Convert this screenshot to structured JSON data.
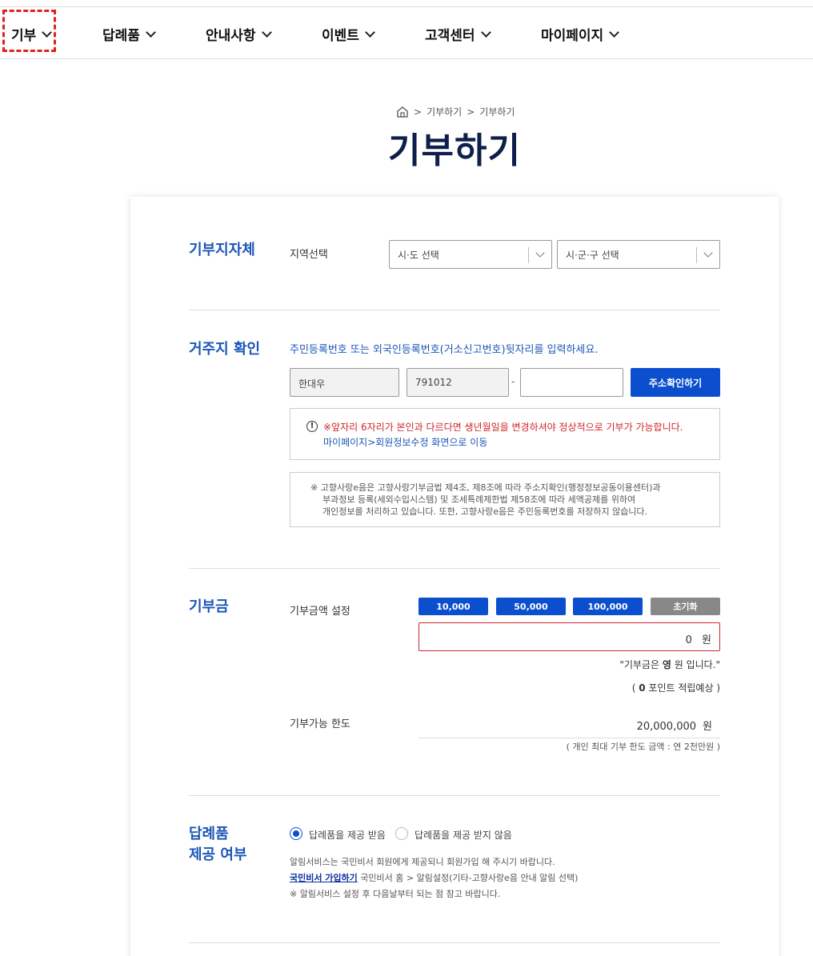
{
  "nav": {
    "items": [
      {
        "label": "기부"
      },
      {
        "label": "답례품"
      },
      {
        "label": "안내사항"
      },
      {
        "label": "이벤트"
      },
      {
        "label": "고객센터"
      },
      {
        "label": "마이페이지"
      }
    ]
  },
  "breadcrumb": {
    "items": [
      "기부하기",
      "기부하기"
    ],
    "separator": ">"
  },
  "page": {
    "title": "기부하기"
  },
  "region": {
    "section_title": "기부지자체",
    "label": "지역선택",
    "sido_placeholder": "시·도 선택",
    "sigungu_placeholder": "시·군·구 선택"
  },
  "residence": {
    "section_title": "거주지 확인",
    "instruction": "주민등록번호 또는 외국인등록번호(거소신고번호)뒷자리를 입력하세요.",
    "name_value": "한대우",
    "birth_value": "791012",
    "dash": "-",
    "rrn_back_value": "",
    "confirm_button": "주소확인하기",
    "warning_text": "※앞자리 6자리가 본인과 다르다면 생년월일을 변경하셔야 정상적으로 기부가 가능합니다.",
    "warning_link": "마이페이지>회원정보수정 화면으로 이동",
    "note_lines": [
      "※ 고향사랑e음은 고향사랑기부금법 제4조, 제8조에 따라 주소지확인(행정정보공동이용센터)과",
      "부과정보 등록(세외수입시스템) 및 조세특례제한법 제58조에 따라 세액공제를 위하여",
      "개인정보를 처리하고 있습니다. 또한, 고향사랑e음은 주민등록번호를 저장하지 않습니다."
    ]
  },
  "donation": {
    "section_title": "기부금",
    "amount_label": "기부금액 설정",
    "buttons": [
      "10,000",
      "50,000",
      "100,000",
      "초기화"
    ],
    "amount_value": "0",
    "unit": "원",
    "summary_prefix": "\"기부금은 ",
    "summary_bold": "영",
    "summary_suffix": " 원 입니다.\"",
    "points_prefix": "( ",
    "points_bold": "0",
    "points_suffix": " 포인트 적립예상 )",
    "limit_label": "기부가능 한도",
    "limit_value": "20,000,000",
    "limit_note": "( 개인 최대 기부 한도 금액 : 연 2천만원 )"
  },
  "gift": {
    "section_title_line1": "답례품",
    "section_title_line2": "제공 여부",
    "option_yes": "답례품을 제공 받음",
    "option_no": "답례품을 제공 받지 않음",
    "info_line1": "알림서비스는 국민비서 회원에게 제공되니 회원가입 해 주시기 바랍니다.",
    "info_link": "국민비서 가입하기",
    "info_line2_rest": " 국민비서 홈 > 알림설정(기타-고향사랑e음 안내 알림 선택)",
    "info_line3": "※ 알림서비스 설정 후 다음날부터 되는 점 참고 바랍니다."
  },
  "colors": {
    "accent": "#0b4fcf",
    "title": "#0d1f4a",
    "section": "#1b56b8",
    "warning": "#d0262a",
    "reset": "#888888"
  }
}
